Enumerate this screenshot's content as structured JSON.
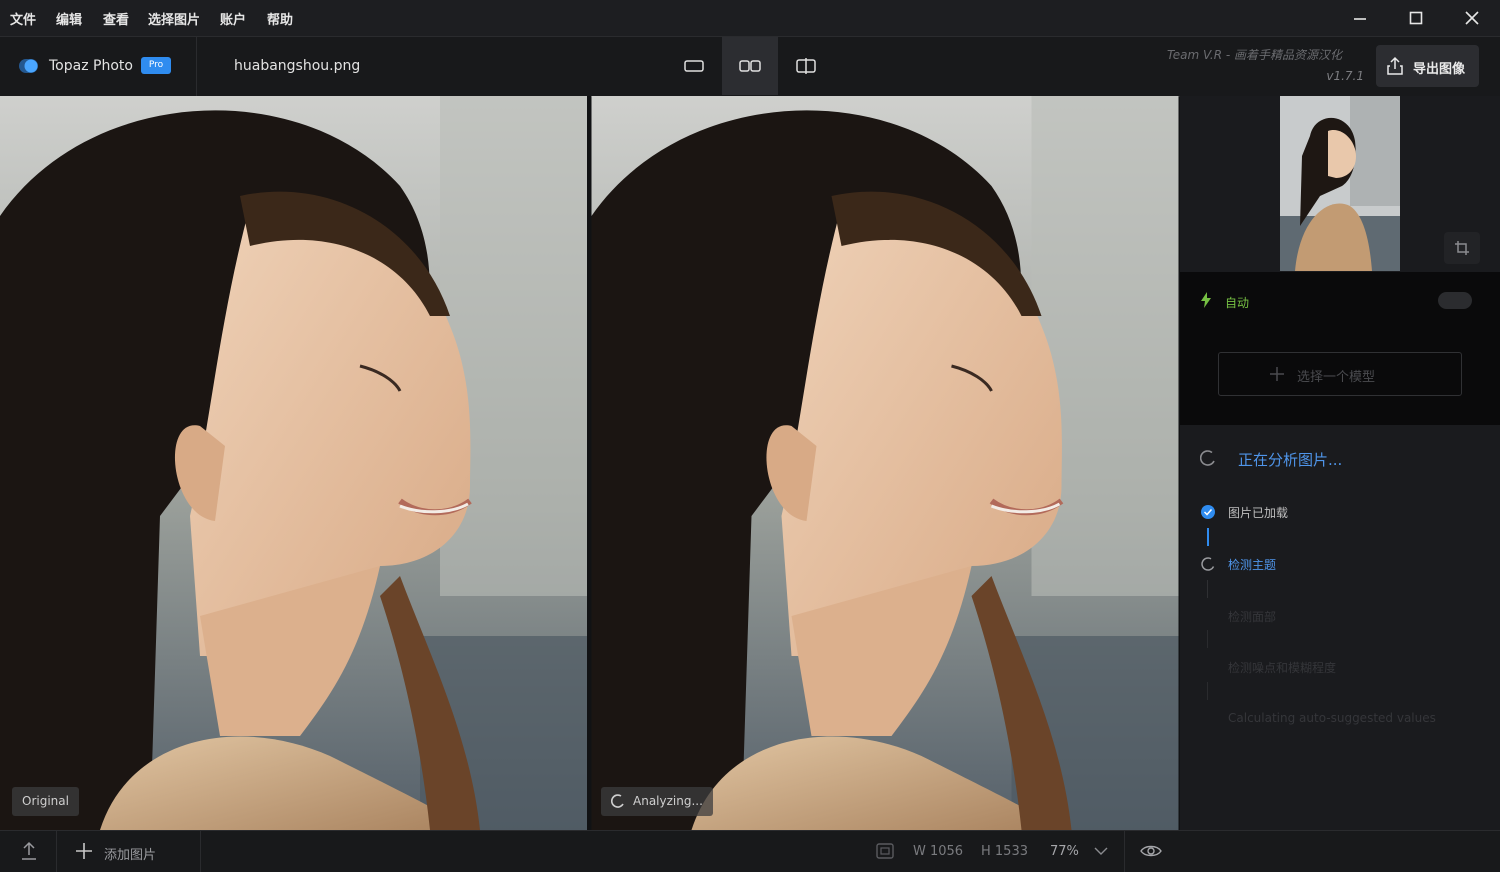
{
  "menu": {
    "items": [
      "文件",
      "编辑",
      "查看",
      "选择图片",
      "账户",
      "帮助"
    ]
  },
  "app": {
    "name": "Topaz Photo",
    "badge": "Pro"
  },
  "file": {
    "name": "huabangshou.png"
  },
  "branding": {
    "team": "Team V.R - 画着手精品资源汉化",
    "version": "v1.7.1"
  },
  "export": {
    "label": "导出图像"
  },
  "panes": {
    "original_label": "Original",
    "processed_label": "Analyzing..."
  },
  "sidebar": {
    "auto_label": "自动",
    "select_model": "选择一个模型",
    "analyzing": "正在分析图片...",
    "steps": [
      {
        "label": "图片已加载",
        "state": "done"
      },
      {
        "label": "检测主题",
        "state": "active"
      },
      {
        "label": "检测面部",
        "state": "pending"
      },
      {
        "label": "检测噪点和模糊程度",
        "state": "pending"
      },
      {
        "label": "Calculating auto-suggested values",
        "state": "pending"
      }
    ]
  },
  "statusbar": {
    "add_image": "添加图片",
    "width": "W 1056",
    "height": "H 1533",
    "zoom": "77%"
  },
  "colors": {
    "accent": "#2f8cf0",
    "auto_green": "#76c043",
    "analyzing_blue": "#4f95ea"
  }
}
